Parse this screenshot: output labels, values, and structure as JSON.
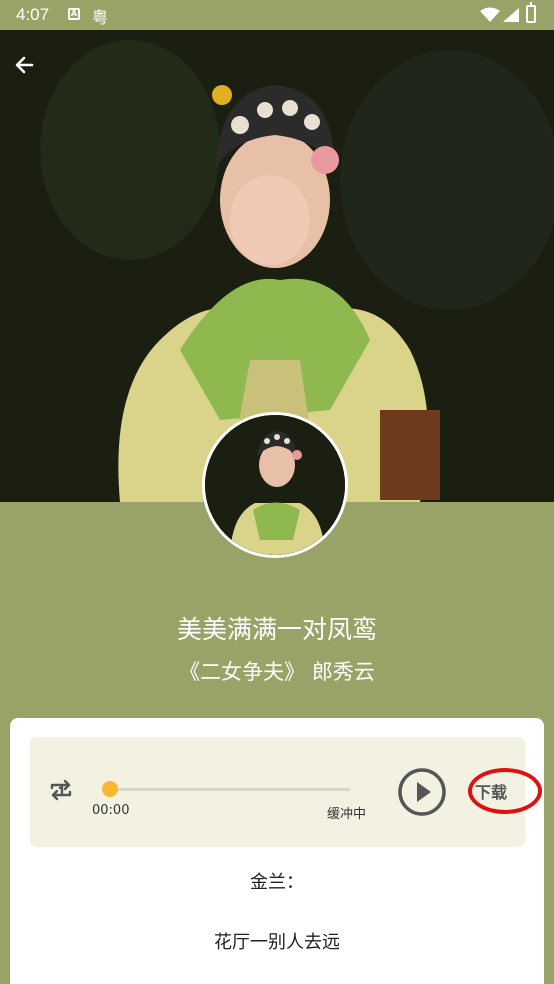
{
  "status_bar": {
    "time": "4:07",
    "notification_a": "A",
    "notification_yue": "粤",
    "icons": [
      "wifi-icon",
      "signal-icon",
      "battery-icon"
    ]
  },
  "header": {
    "back_icon": "arrow-left-icon"
  },
  "song": {
    "title": "美美满满一对凤鸾",
    "subtitle": "《二女争夫》 郎秀云"
  },
  "player": {
    "repeat_icon": "repeat-icon",
    "current_time": "00:00",
    "status": "缓冲中",
    "progress": 0,
    "play_icon": "play-icon",
    "download_label": "下载"
  },
  "lyrics": {
    "speaker": "金兰：",
    "lines": [
      "花厅一别人去远"
    ]
  },
  "colors": {
    "theme_green": "#9aa367",
    "player_bg": "#f3f2e2",
    "progress_thumb": "#f7b731",
    "highlight_ring": "#e01010"
  }
}
